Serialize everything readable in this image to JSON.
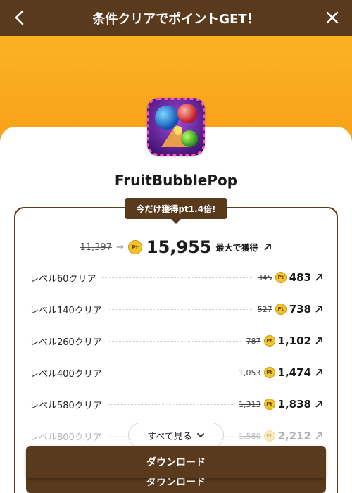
{
  "header": {
    "title": "条件クリアでポイントGET！",
    "back_icon": "chevron-left-icon",
    "close_icon": "close-icon"
  },
  "app": {
    "name": "FruitBubblePop"
  },
  "promo_badge": "今だけ獲得pt1.4倍!",
  "summary": {
    "old_total": "11,397",
    "new_total": "15,955",
    "max_label": "最大で獲得"
  },
  "coin_label": "Pt",
  "levels": [
    {
      "label": "レベル60クリア",
      "old": "345",
      "value": "483"
    },
    {
      "label": "レベル140クリア",
      "old": "527",
      "value": "738"
    },
    {
      "label": "レベル260クリア",
      "old": "787",
      "value": "1,102"
    },
    {
      "label": "レベル400クリア",
      "old": "1,053",
      "value": "1,474"
    },
    {
      "label": "レベル580クリア",
      "old": "1,313",
      "value": "1,838"
    },
    {
      "label": "レベル800クリア",
      "old": "1,580",
      "value": "2,212"
    }
  ],
  "see_all_label": "すべて見る",
  "download_label": "ダウンロード",
  "colors": {
    "brand_brown": "#5a3a1c",
    "hero_orange": "#f8a018",
    "coin_gold": "#f3c42a"
  }
}
